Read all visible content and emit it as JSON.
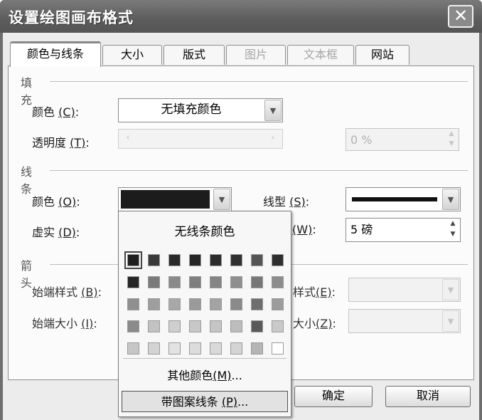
{
  "dialog": {
    "title": "设置绘图画布格式",
    "close_symbol": "✕"
  },
  "tabs": [
    {
      "label": "颜色与线条",
      "state": "active"
    },
    {
      "label": "大小",
      "state": "normal"
    },
    {
      "label": "版式",
      "state": "normal"
    },
    {
      "label": "图片",
      "state": "disabled"
    },
    {
      "label": "文本框",
      "state": "disabled"
    },
    {
      "label": "网站",
      "state": "normal"
    }
  ],
  "fill": {
    "group_label": "填充",
    "color_label": "颜色",
    "color_key": "(C)",
    "color_colon": ":",
    "color_value": "无填充颜色",
    "transparency_label": "透明度",
    "transparency_key": "(T)",
    "transparency_colon": ":",
    "transparency_value": "0 %"
  },
  "line": {
    "group_label": "线条",
    "color_label": "颜色",
    "color_key": "(O)",
    "color_colon": ":",
    "color_swatch": "#1c1c1c",
    "style_label": "线型",
    "style_key": "(S)",
    "style_colon": ":",
    "dash_label": "虚实",
    "dash_key": "(D)",
    "dash_colon": ":",
    "weight_key": "(W)",
    "weight_colon": ":",
    "weight_value": "5 磅"
  },
  "arrows": {
    "group_label": "箭头",
    "begin_style_label": "始端样式",
    "begin_style_key": "(B)",
    "begin_style_colon": ":",
    "begin_size_label": "始端大小",
    "begin_size_key": "(I)",
    "begin_size_colon": ":",
    "end_style_label": "样式",
    "end_style_key": "(E)",
    "end_style_colon": ":",
    "end_size_label": "大小",
    "end_size_key": "(Z)",
    "end_size_colon": ":"
  },
  "buttons": {
    "ok": "确定",
    "cancel": "取消"
  },
  "color_popup": {
    "no_line": "无线条颜色",
    "more_colors_label": "其他颜色",
    "more_colors_key": "(M)",
    "more_colors_suffix": "...",
    "patterned_label": "带图案线条",
    "patterned_key": "(P)",
    "patterned_suffix": "...",
    "palette": [
      [
        "#1f1f1f",
        "#3a3a3a",
        "#2a2a2a",
        "#262626",
        "#2c2c2c",
        "#303030",
        "#555555",
        "#2e2e2e"
      ],
      [
        "#252525",
        "#7a7a7a",
        "#8a8a8a",
        "#7e7e7e",
        "#858585",
        "#8e8e8e",
        "#777777",
        "#8c8c8c"
      ],
      [
        "#8f8f8f",
        "#9e9e9e",
        "#a8a8a8",
        "#9a9a9a",
        "#a3a3a3",
        "#8a8a8a",
        "#6e6e6e",
        "#9c9c9c"
      ],
      [
        "#8a8a8a",
        "#c2c2c2",
        "#cfcfcf",
        "#c8c8c8",
        "#c5c5c5",
        "#bdbdbd",
        "#5a5a5a",
        "#c9c9c9"
      ],
      [
        "#c6c6c6",
        "#d3d3d3",
        "#e2e2e2",
        "#dcdcdc",
        "#d9d9d9",
        "#d4d4d4",
        "#b5b5b5",
        "#ffffff"
      ]
    ]
  }
}
